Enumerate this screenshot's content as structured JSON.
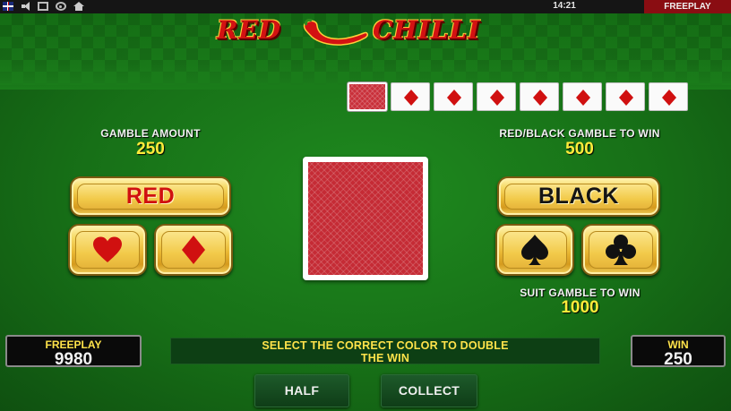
{
  "system_bar": {
    "clock": "14:21",
    "mode_tab": "FREEPLAY",
    "icons": [
      "uk-flag-icon",
      "speaker-icon",
      "fullscreen-icon",
      "settings-icon",
      "home-icon"
    ]
  },
  "logo": {
    "word1": "RED",
    "word2": "CHILLI"
  },
  "history": {
    "cards": [
      "card-back",
      "diamond",
      "diamond",
      "diamond",
      "diamond",
      "diamond",
      "diamond",
      "diamond"
    ]
  },
  "gamble_amount": {
    "label": "GAMBLE AMOUNT",
    "value": "250"
  },
  "red_black_gamble": {
    "label": "RED/BLACK GAMBLE TO WIN",
    "value": "500"
  },
  "suit_gamble": {
    "label": "SUIT GAMBLE TO WIN",
    "value": "1000"
  },
  "buttons": {
    "red": "RED",
    "black": "BLACK",
    "half": "HALF",
    "collect": "COLLECT"
  },
  "suits": {
    "left": [
      "heart-icon",
      "diamond-icon"
    ],
    "right": [
      "spade-icon",
      "club-icon"
    ]
  },
  "freeplay_panel": {
    "label": "FREEPLAY",
    "value": "9980"
  },
  "win_panel": {
    "label": "WIN",
    "value": "250"
  },
  "message": {
    "line1": "SELECT THE CORRECT COLOR TO DOUBLE",
    "line2": "THE WIN"
  },
  "colors": {
    "felt": "#177017",
    "gold": "#e9b733",
    "red_suit": "#d01010",
    "accent_yellow": "#ffec3a",
    "tab_red": "#8a0d12"
  }
}
